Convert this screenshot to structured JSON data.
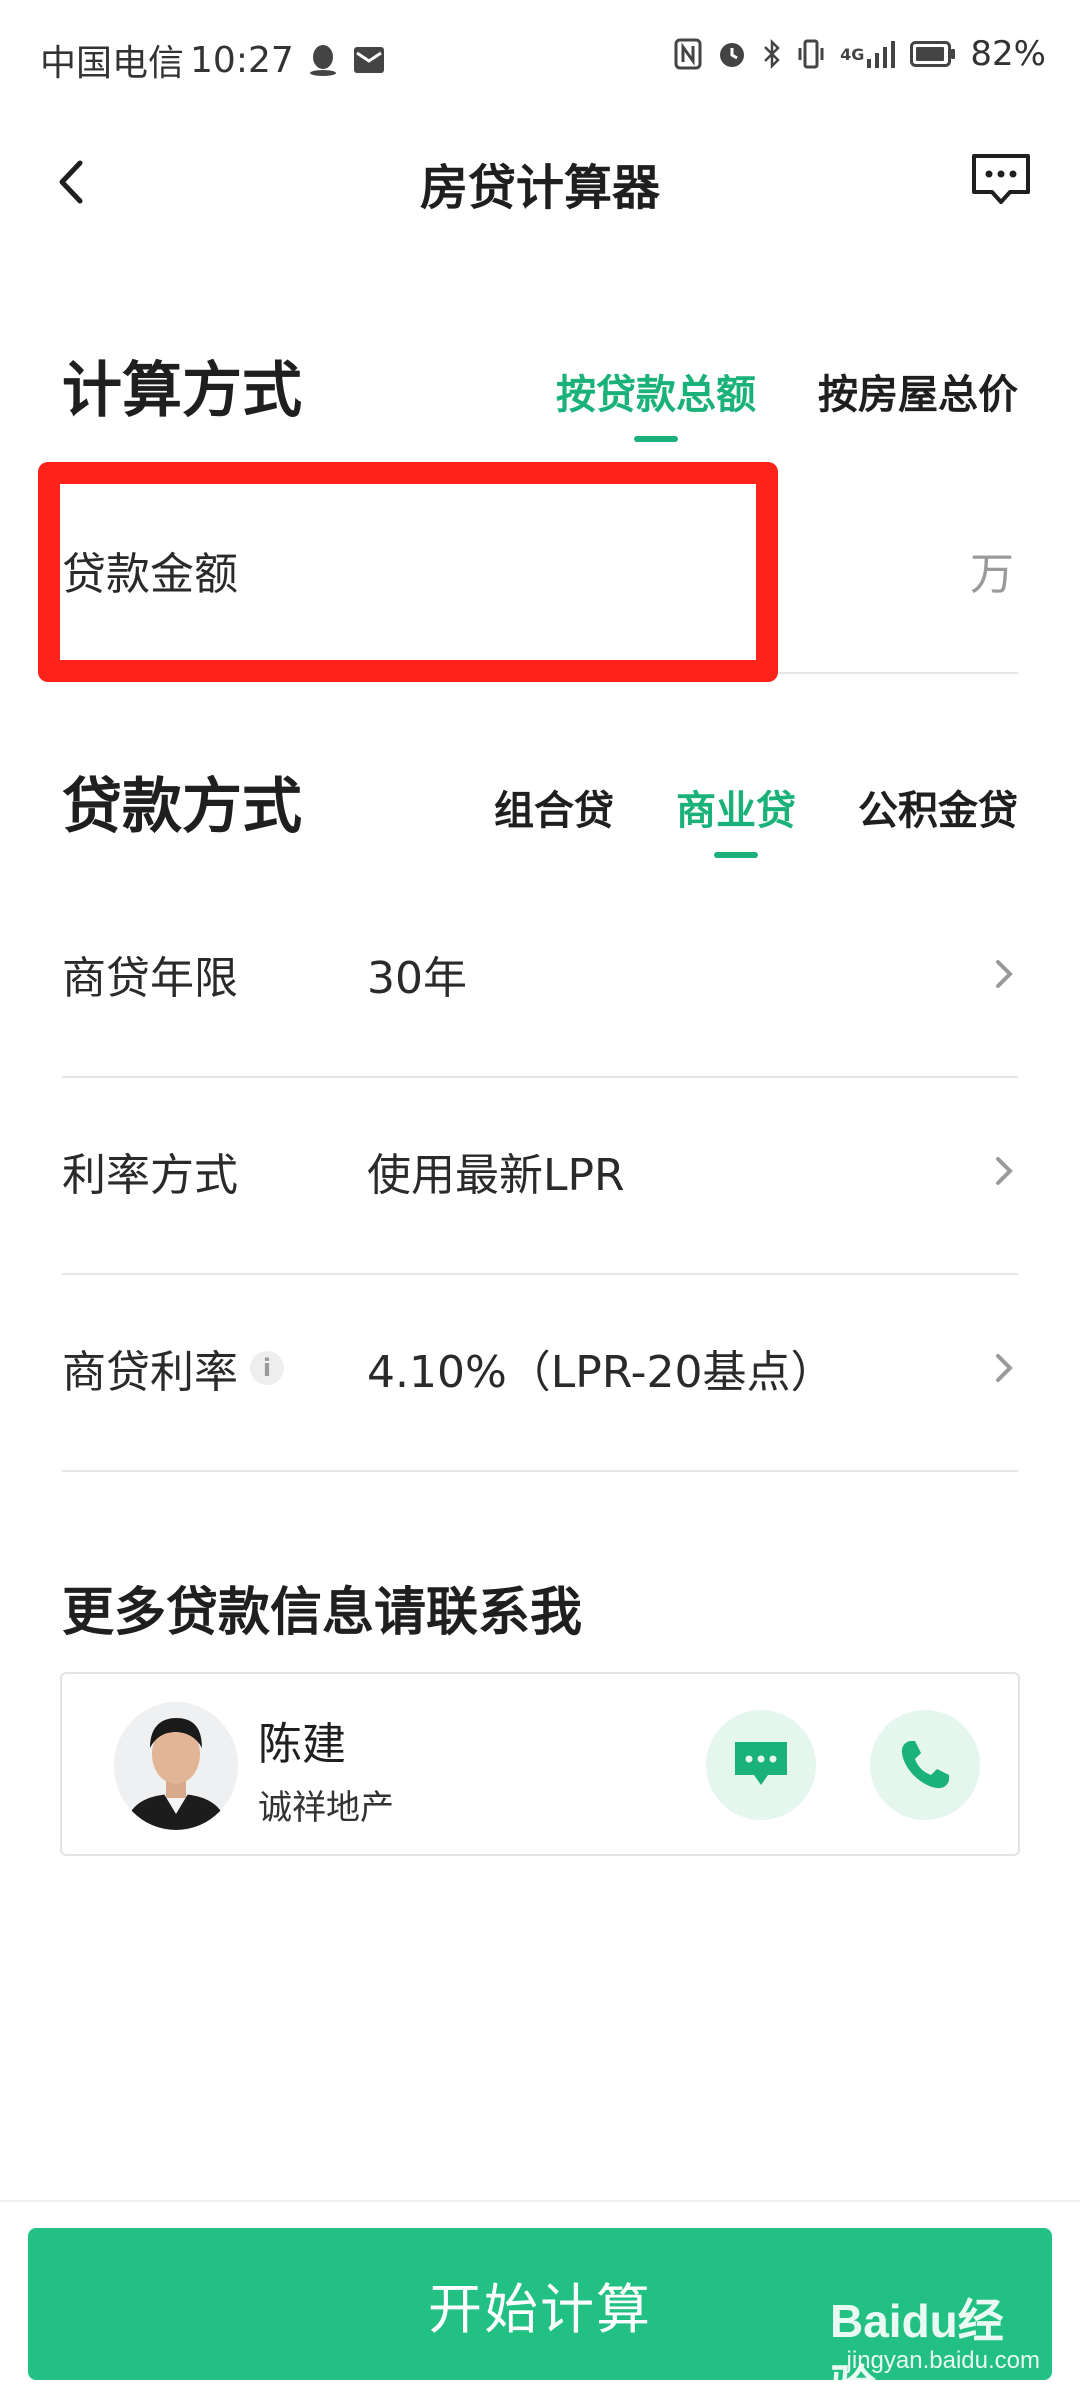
{
  "status_bar": {
    "carrier": "中国电信",
    "time": "10:27",
    "battery": "82%",
    "network": "4G",
    "icons": [
      "qq-icon",
      "mail-icon",
      "nfc-icon",
      "alarm-icon",
      "bluetooth-icon",
      "vibrate-icon",
      "signal-icon",
      "battery-icon"
    ]
  },
  "nav": {
    "title": "房贷计算器"
  },
  "calc_method": {
    "title": "计算方式",
    "tabs": [
      {
        "label": "按贷款总额",
        "active": true
      },
      {
        "label": "按房屋总价",
        "active": false
      }
    ],
    "loan_amount": {
      "label": "贷款金额",
      "unit": "万"
    }
  },
  "loan_method": {
    "title": "贷款方式",
    "tabs": [
      {
        "label": "组合贷",
        "active": false
      },
      {
        "label": "商业贷",
        "active": true
      },
      {
        "label": "公积金贷",
        "active": false
      }
    ],
    "rows": [
      {
        "label": "商贷年限",
        "value": "30年"
      },
      {
        "label": "利率方式",
        "value": "使用最新LPR"
      },
      {
        "label": "商贷利率",
        "value": "4.10%（LPR-20基点）"
      }
    ]
  },
  "contact": {
    "heading": "更多贷款信息请联系我",
    "name": "陈建",
    "company": "诚祥地产"
  },
  "actions": {
    "start_label": "开始计算"
  },
  "watermark": {
    "logo": "Baidu经验",
    "url": "jingyan.baidu.com"
  },
  "colors": {
    "accent": "#1ab27a",
    "button": "#22c183",
    "highlight": "#ff2319"
  }
}
